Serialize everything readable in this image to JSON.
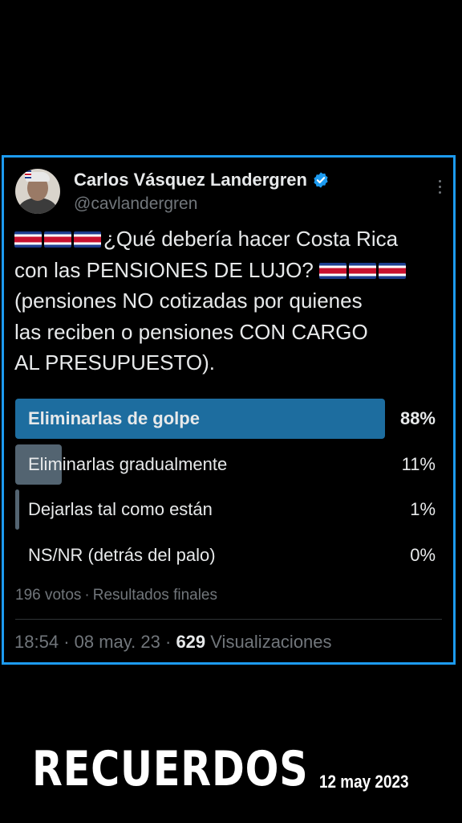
{
  "tweet": {
    "author_name": "Carlos Vásquez Landergren",
    "handle": "@cavlandergren",
    "text_line_1": "¿Qué debería hacer Costa Rica",
    "text_line_2": "con las PENSIONES DE LUJO?",
    "text_line_3": "(pensiones NO cotizadas por quienes",
    "text_line_4": "las reciben o pensiones CON CARGO",
    "text_line_5": "AL PRESUPUESTO).",
    "colors": {
      "accent": "#1d9bf0",
      "winner_bar": "#1d6d9f",
      "bar": "#536471",
      "muted": "#71767b"
    }
  },
  "poll": {
    "options": [
      {
        "label": "Eliminarlas de golpe",
        "percent_label": "88%",
        "percent": 88
      },
      {
        "label": "Eliminarlas gradualmente",
        "percent_label": "11%",
        "percent": 11
      },
      {
        "label": "Dejarlas tal como están",
        "percent_label": "1%",
        "percent": 1
      },
      {
        "label": "NS/NR (detrás del palo)",
        "percent_label": "0%",
        "percent": 0
      }
    ],
    "votes": "196 votos",
    "status": "Resultados finales"
  },
  "footer": {
    "time": "18:54",
    "date": "08 may. 23",
    "views_count": "629",
    "views_label": "Visualizaciones"
  },
  "overlay": {
    "title": "RECUERDOS",
    "date": "12 may 2023"
  }
}
